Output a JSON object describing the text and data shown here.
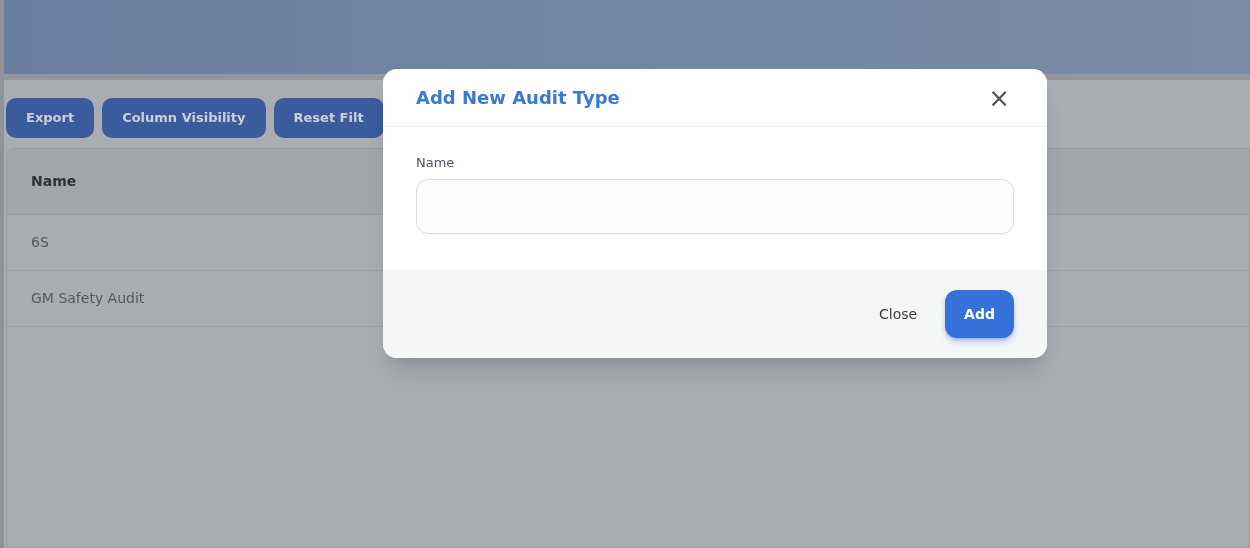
{
  "toolbar": {
    "buttons": [
      "Export",
      "Column Visibility",
      "Reset Filt"
    ]
  },
  "table": {
    "columns": [
      "Name"
    ],
    "rows": [
      [
        "6S"
      ],
      [
        "GM Safety Audit"
      ]
    ]
  },
  "modal": {
    "title": "Add New Audit Type",
    "close_icon": "×",
    "field": {
      "label": "Name"
    },
    "buttons": [
      {
        "label": "Close",
        "kind": "plain"
      },
      {
        "label": "Add",
        "kind": "primary"
      }
    ]
  }
}
